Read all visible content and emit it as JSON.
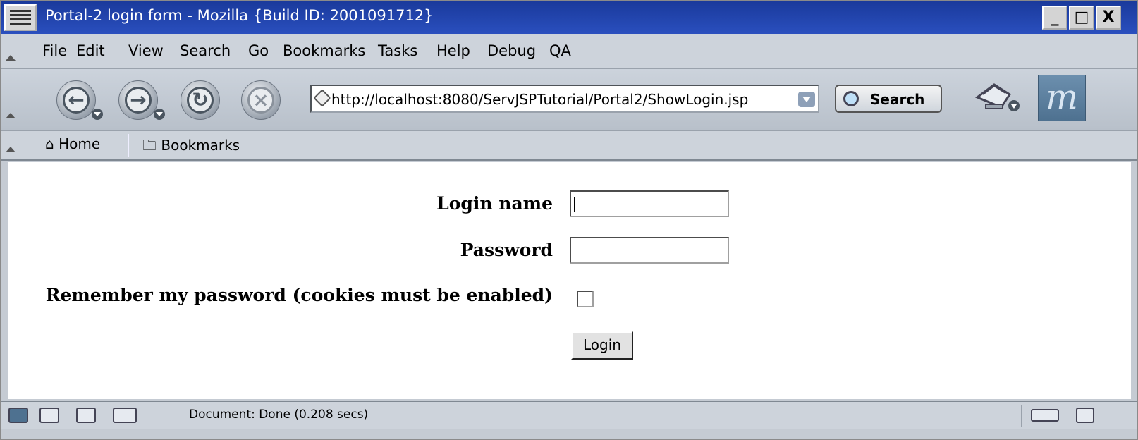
{
  "window": {
    "title": "Portal-2 login form - Mozilla {Build ID: 2001091712}",
    "minimize_label": "_",
    "maximize_label": "□",
    "close_label": "X"
  },
  "menubar": {
    "items": [
      {
        "label": "File"
      },
      {
        "label": "Edit"
      },
      {
        "label": "View"
      },
      {
        "label": "Search"
      },
      {
        "label": "Go"
      },
      {
        "label": "Bookmarks"
      },
      {
        "label": "Tasks"
      },
      {
        "label": "Help"
      },
      {
        "label": "Debug"
      },
      {
        "label": "QA"
      }
    ]
  },
  "navbar": {
    "back_glyph": "←",
    "forward_glyph": "→",
    "reload_glyph": "↻",
    "stop_glyph": "×",
    "url": "http://localhost:8080/ServJSPTutorial/Portal2/ShowLogin.jsp",
    "search_label": "Search"
  },
  "personal_toolbar": {
    "home_label": "Home",
    "bookmarks_label": "Bookmarks"
  },
  "form": {
    "login_label": "Login name",
    "login_value": "",
    "password_label": "Password",
    "password_value": "",
    "remember_label": "Remember my password (cookies must be enabled)",
    "remember_checked": false,
    "submit_label": "Login"
  },
  "statusbar": {
    "text": "Document: Done (0.208 secs)"
  },
  "icons": {
    "sysmenu": "menu-icon",
    "back": "back-arrow-icon",
    "forward": "forward-arrow-icon",
    "reload": "reload-icon",
    "stop": "stop-icon",
    "url": "page-icon",
    "search": "magnifier-icon",
    "print": "print-icon",
    "logo": "mozilla-logo-icon",
    "home": "home-icon",
    "bookmarks": "folder-icon",
    "status": [
      "navigator-icon",
      "mail-icon",
      "composer-icon",
      "addressbook-icon",
      "connection-icon",
      "lock-icon"
    ]
  }
}
